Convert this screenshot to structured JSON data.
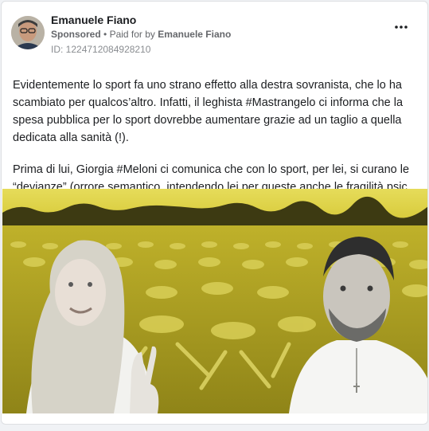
{
  "post": {
    "author_name": "Emanuele Fiano",
    "sponsored_label": "Sponsored",
    "separator": "•",
    "paid_for_prefix": "Paid for by",
    "paid_for_name": "Emanuele Fiano",
    "ad_id": "ID: 1224712084928210",
    "more_icon": "more-horizontal-icon",
    "paragraphs": [
      "Evidentemente lo sport fa uno strano effetto alla destra sovranista, che lo ha scambiato per qualcos’altro. Infatti, il leghista #Mastrangelo ci informa che la spesa pubblica per lo sport dovrebbe aumentare grazie ad un taglio a quella dedicata alla sanità (!).",
      "Prima di lui, Giorgia #Meloni ci comunica che con lo sport, per lei, si curano le",
      "“devianze” (orrore semantico, intendendo lei per queste anche le fragilità psichiche"
    ]
  },
  "colors": {
    "background": "#f0f2f5",
    "card": "#ffffff",
    "secondary_text": "#65676b",
    "image_tint": "#d4c836"
  }
}
